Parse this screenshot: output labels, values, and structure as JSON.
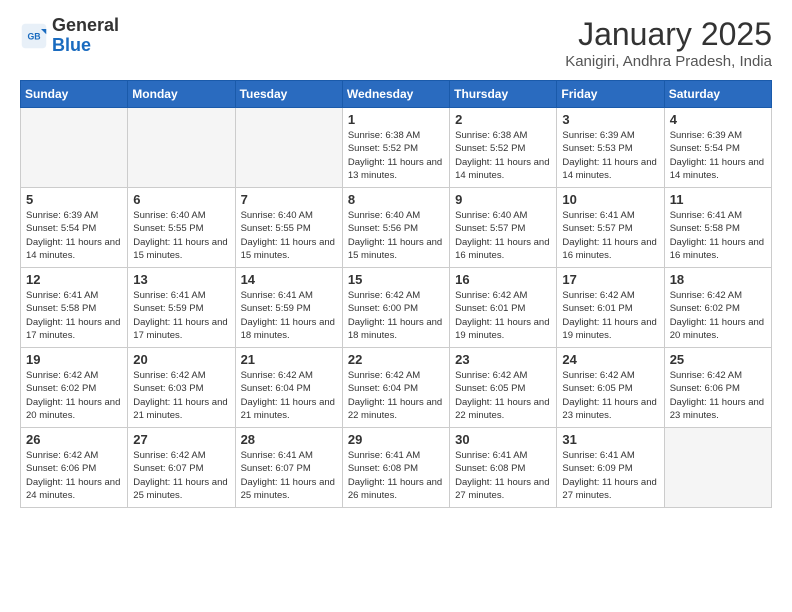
{
  "header": {
    "logo_general": "General",
    "logo_blue": "Blue",
    "month_year": "January 2025",
    "location": "Kanigiri, Andhra Pradesh, India"
  },
  "days_of_week": [
    "Sunday",
    "Monday",
    "Tuesday",
    "Wednesday",
    "Thursday",
    "Friday",
    "Saturday"
  ],
  "weeks": [
    [
      {
        "day": "",
        "empty": true
      },
      {
        "day": "",
        "empty": true
      },
      {
        "day": "",
        "empty": true
      },
      {
        "day": "1",
        "sunrise": "6:38 AM",
        "sunset": "5:52 PM",
        "daylight": "11 hours and 13 minutes."
      },
      {
        "day": "2",
        "sunrise": "6:38 AM",
        "sunset": "5:52 PM",
        "daylight": "11 hours and 14 minutes."
      },
      {
        "day": "3",
        "sunrise": "6:39 AM",
        "sunset": "5:53 PM",
        "daylight": "11 hours and 14 minutes."
      },
      {
        "day": "4",
        "sunrise": "6:39 AM",
        "sunset": "5:54 PM",
        "daylight": "11 hours and 14 minutes."
      }
    ],
    [
      {
        "day": "5",
        "sunrise": "6:39 AM",
        "sunset": "5:54 PM",
        "daylight": "11 hours and 14 minutes."
      },
      {
        "day": "6",
        "sunrise": "6:40 AM",
        "sunset": "5:55 PM",
        "daylight": "11 hours and 15 minutes."
      },
      {
        "day": "7",
        "sunrise": "6:40 AM",
        "sunset": "5:55 PM",
        "daylight": "11 hours and 15 minutes."
      },
      {
        "day": "8",
        "sunrise": "6:40 AM",
        "sunset": "5:56 PM",
        "daylight": "11 hours and 15 minutes."
      },
      {
        "day": "9",
        "sunrise": "6:40 AM",
        "sunset": "5:57 PM",
        "daylight": "11 hours and 16 minutes."
      },
      {
        "day": "10",
        "sunrise": "6:41 AM",
        "sunset": "5:57 PM",
        "daylight": "11 hours and 16 minutes."
      },
      {
        "day": "11",
        "sunrise": "6:41 AM",
        "sunset": "5:58 PM",
        "daylight": "11 hours and 16 minutes."
      }
    ],
    [
      {
        "day": "12",
        "sunrise": "6:41 AM",
        "sunset": "5:58 PM",
        "daylight": "11 hours and 17 minutes."
      },
      {
        "day": "13",
        "sunrise": "6:41 AM",
        "sunset": "5:59 PM",
        "daylight": "11 hours and 17 minutes."
      },
      {
        "day": "14",
        "sunrise": "6:41 AM",
        "sunset": "5:59 PM",
        "daylight": "11 hours and 18 minutes."
      },
      {
        "day": "15",
        "sunrise": "6:42 AM",
        "sunset": "6:00 PM",
        "daylight": "11 hours and 18 minutes."
      },
      {
        "day": "16",
        "sunrise": "6:42 AM",
        "sunset": "6:01 PM",
        "daylight": "11 hours and 19 minutes."
      },
      {
        "day": "17",
        "sunrise": "6:42 AM",
        "sunset": "6:01 PM",
        "daylight": "11 hours and 19 minutes."
      },
      {
        "day": "18",
        "sunrise": "6:42 AM",
        "sunset": "6:02 PM",
        "daylight": "11 hours and 20 minutes."
      }
    ],
    [
      {
        "day": "19",
        "sunrise": "6:42 AM",
        "sunset": "6:02 PM",
        "daylight": "11 hours and 20 minutes."
      },
      {
        "day": "20",
        "sunrise": "6:42 AM",
        "sunset": "6:03 PM",
        "daylight": "11 hours and 21 minutes."
      },
      {
        "day": "21",
        "sunrise": "6:42 AM",
        "sunset": "6:04 PM",
        "daylight": "11 hours and 21 minutes."
      },
      {
        "day": "22",
        "sunrise": "6:42 AM",
        "sunset": "6:04 PM",
        "daylight": "11 hours and 22 minutes."
      },
      {
        "day": "23",
        "sunrise": "6:42 AM",
        "sunset": "6:05 PM",
        "daylight": "11 hours and 22 minutes."
      },
      {
        "day": "24",
        "sunrise": "6:42 AM",
        "sunset": "6:05 PM",
        "daylight": "11 hours and 23 minutes."
      },
      {
        "day": "25",
        "sunrise": "6:42 AM",
        "sunset": "6:06 PM",
        "daylight": "11 hours and 23 minutes."
      }
    ],
    [
      {
        "day": "26",
        "sunrise": "6:42 AM",
        "sunset": "6:06 PM",
        "daylight": "11 hours and 24 minutes."
      },
      {
        "day": "27",
        "sunrise": "6:42 AM",
        "sunset": "6:07 PM",
        "daylight": "11 hours and 25 minutes."
      },
      {
        "day": "28",
        "sunrise": "6:41 AM",
        "sunset": "6:07 PM",
        "daylight": "11 hours and 25 minutes."
      },
      {
        "day": "29",
        "sunrise": "6:41 AM",
        "sunset": "6:08 PM",
        "daylight": "11 hours and 26 minutes."
      },
      {
        "day": "30",
        "sunrise": "6:41 AM",
        "sunset": "6:08 PM",
        "daylight": "11 hours and 27 minutes."
      },
      {
        "day": "31",
        "sunrise": "6:41 AM",
        "sunset": "6:09 PM",
        "daylight": "11 hours and 27 minutes."
      },
      {
        "day": "",
        "empty": true
      }
    ]
  ]
}
